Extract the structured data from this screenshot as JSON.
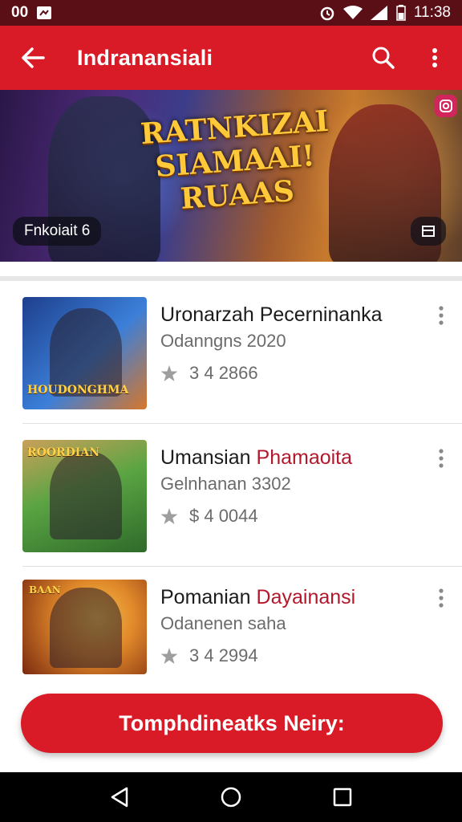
{
  "status_bar": {
    "left_text": "00",
    "time": "11:38"
  },
  "app_bar": {
    "title": "Indranansiali"
  },
  "banner": {
    "logo_text": "RATNKIZAI SIAMAAI! RUAAS",
    "chip_label": "Fnkoiait 6"
  },
  "list": {
    "items": [
      {
        "name_main": "Uronarzah",
        "name_accent": "",
        "name_rest": "Pecerninanka",
        "subtitle": "Odanngns 2020",
        "rating_text": "3 4 2866",
        "thumb_caption": "HOUDONGHMA",
        "thumb_colors": [
          "#1e3f8c",
          "#3b7fd9",
          "#d7772b"
        ]
      },
      {
        "name_main": "Umansian",
        "name_accent": "Phamaoita",
        "name_rest": "",
        "subtitle": "Gelnhanan 3302",
        "rating_text": "$ 4 0044",
        "thumb_caption": "ROORDIAN",
        "thumb_colors": [
          "#2f6a2a",
          "#5aa443",
          "#c9a05a"
        ]
      },
      {
        "name_main": "Pomanian",
        "name_accent": "Dayainansi",
        "name_rest": "",
        "subtitle": "Odanenen saha",
        "rating_text": "3 4 2994",
        "thumb_caption": "BAAN",
        "thumb_colors": [
          "#7a2a10",
          "#e0882a",
          "#f5c04a"
        ]
      }
    ]
  },
  "cta": {
    "label": "Tomphdineatks Neiry:"
  },
  "colors": {
    "primary": "#d81b26",
    "status_bar": "#5a0f17",
    "accent_text": "#b2182b"
  }
}
